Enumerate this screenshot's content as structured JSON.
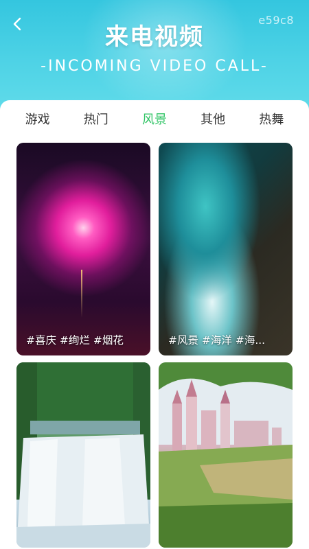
{
  "header": {
    "title_cn": "来电视频",
    "title_en": "-INCOMING VIDEO CALL-",
    "code": "e59c8"
  },
  "tabs": [
    {
      "label": "游戏"
    },
    {
      "label": "热门"
    },
    {
      "label": "风景"
    },
    {
      "label": "其他"
    },
    {
      "label": "热舞"
    }
  ],
  "active_tab": "风景",
  "cards": [
    {
      "tags": "#喜庆 #绚烂 #烟花"
    },
    {
      "tags": "#风景 #海洋 #海..."
    }
  ],
  "colors": {
    "header_bg": "#3fcbe2",
    "active_tab": "#2fc464"
  }
}
